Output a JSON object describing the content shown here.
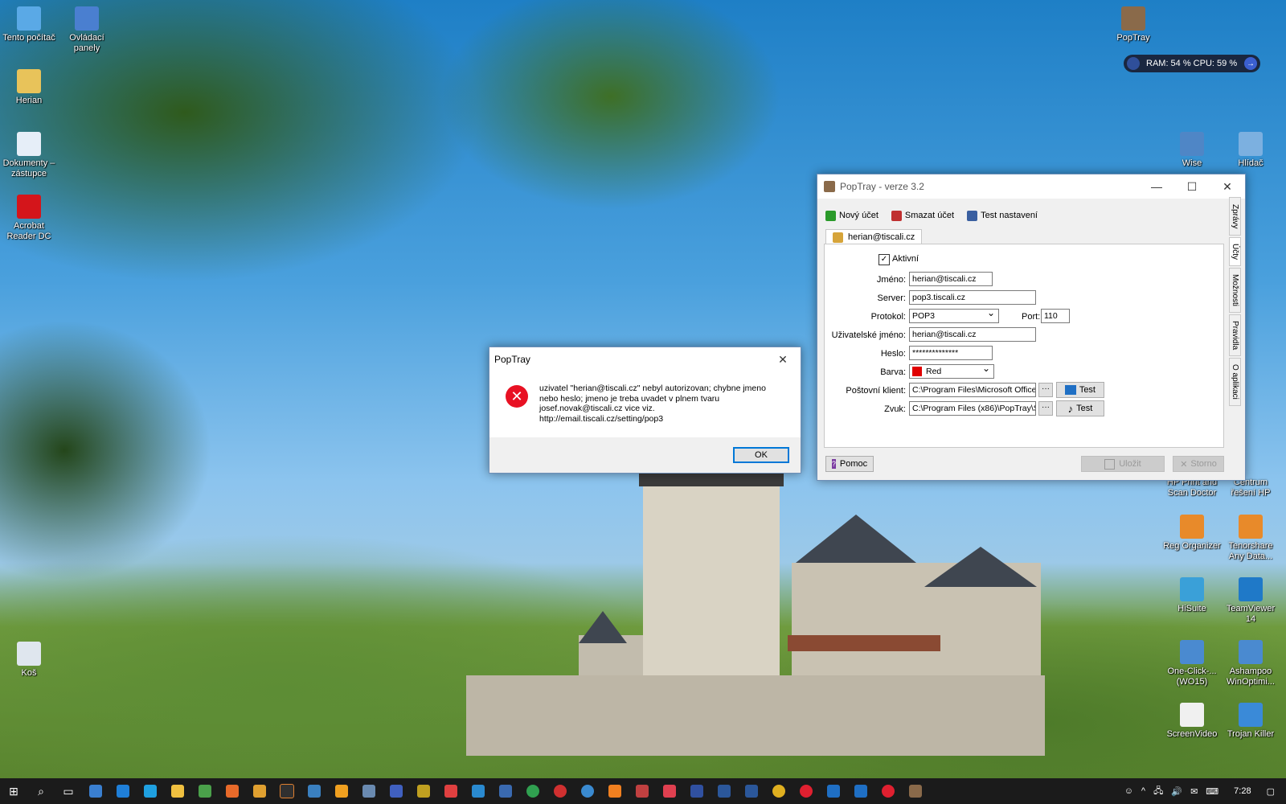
{
  "desktop": {
    "left_icons": [
      {
        "label": "Tento počítač",
        "color": "#5aa9e6"
      },
      {
        "label": "Ovládací panely",
        "color": "#4a7fd0"
      },
      {
        "label": "Herian",
        "color": "#e8c35a"
      },
      {
        "label": "Dokumenty – zástupce",
        "color": "#e6eef8"
      },
      {
        "label": "Acrobat Reader DC",
        "color": "#d4151b"
      },
      {
        "label": "Koš",
        "color": "#dfe6ee"
      }
    ],
    "right_icons": [
      {
        "label": "PopTray",
        "color": "#8a6a4a"
      },
      {
        "label": "Wise",
        "color": "#4f86c6"
      },
      {
        "label": "Hlídač",
        "color": "#7cb0e0"
      },
      {
        "label": "HP Print and Scan Doctor",
        "color": "#1f6fb5"
      },
      {
        "label": "Centrum řešení HP",
        "color": "#1f6fb5"
      },
      {
        "label": "Reg Organizer",
        "color": "#e88a2a"
      },
      {
        "label": "Tenorshare Any Data...",
        "color": "#e88a2a"
      },
      {
        "label": "HiSuite",
        "color": "#3aa0d8"
      },
      {
        "label": "TeamViewer 14",
        "color": "#1f79c8"
      },
      {
        "label": "One-Click-... (WO15)",
        "color": "#4a8ad0"
      },
      {
        "label": "Ashampoo WinOptimi...",
        "color": "#4a8ad0"
      },
      {
        "label": "ScreenVideo",
        "color": "#f0f0f0"
      },
      {
        "label": "Trojan Killer",
        "color": "#3a8ad8"
      }
    ]
  },
  "perf_widget": {
    "text": "RAM: 54 %  CPU: 59 %",
    "arrow": "→"
  },
  "message_box": {
    "title": "PopTray",
    "close": "✕",
    "icon": "error-icon",
    "text": " uzivatel \"herian@tiscali.cz\" nebyl autorizovan; chybne jmeno\nnebo heslo; jmeno je treba uvadet v plnem tvaru\njosef.novak@tiscali.cz vice viz.\nhttp://email.tiscali.cz/setting/pop3",
    "ok_label": "OK"
  },
  "poptray": {
    "title": "PopTray - verze 3.2",
    "controls": {
      "minimize": "—",
      "maximize": "☐",
      "close": "✕"
    },
    "toolbar": [
      {
        "label": "Nový účet",
        "color": "#2a9a2a"
      },
      {
        "label": "Smazat účet",
        "color": "#c03030"
      },
      {
        "label": "Test nastavení",
        "color": "#3a5fa0"
      }
    ],
    "account_tab": "herian@tiscali.cz",
    "active_label": "Aktivní",
    "active_checked": "✓",
    "fields": {
      "jmeno_label": "Jméno:",
      "jmeno": "herian@tiscali.cz",
      "server_label": "Server:",
      "server": "pop3.tiscali.cz",
      "protokol_label": "Protokol:",
      "protokol": "POP3",
      "port_label": "Port:",
      "port": "110",
      "user_label": "Uživatelské jméno:",
      "user": "herian@tiscali.cz",
      "heslo_label": "Heslo:",
      "heslo": "**************",
      "barva_label": "Barva:",
      "barva": "Red",
      "barva_color": "#e00000",
      "klient_label": "Poštovní klient:",
      "klient": "C:\\Program Files\\Microsoft Office\\",
      "zvuk_label": "Zvuk:",
      "zvuk": "C:\\Program Files (x86)\\PopTray\\S",
      "dots": "···",
      "test_label": "Test"
    },
    "side_tabs": [
      "Zprávy",
      "Účty",
      "Možnosti",
      "Pravidla",
      "O aplikaci"
    ],
    "help_label": "Pomoc",
    "save_label": "Uložit",
    "cancel_label": "Storno"
  },
  "taskbar": {
    "clock": "7:28",
    "tray_icons": [
      "^",
      "🖧",
      "🔊",
      "✉",
      "⌨"
    ]
  }
}
